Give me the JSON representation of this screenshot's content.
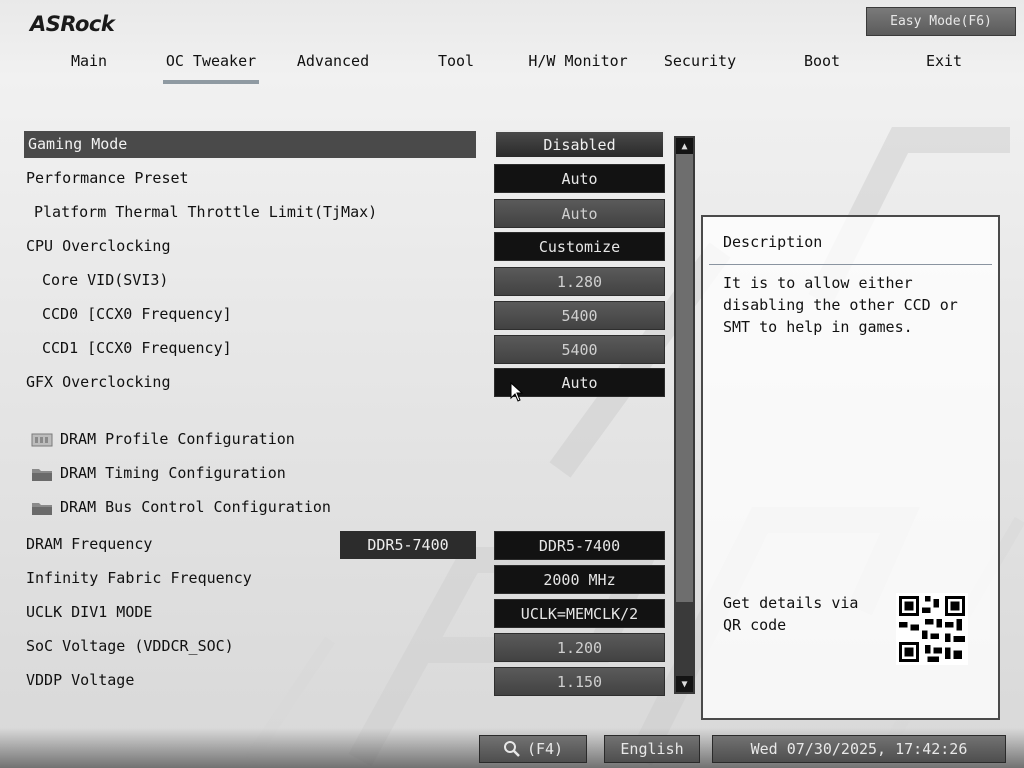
{
  "brand": "ASRock",
  "easy_mode_label": "Easy Mode(F6)",
  "tabs": [
    {
      "label": "Main"
    },
    {
      "label": "OC Tweaker"
    },
    {
      "label": "Advanced"
    },
    {
      "label": "Tool"
    },
    {
      "label": "H/W Monitor"
    },
    {
      "label": "Security"
    },
    {
      "label": "Boot"
    },
    {
      "label": "Exit"
    }
  ],
  "settings": [
    {
      "label": "Gaming Mode",
      "value": "Disabled"
    },
    {
      "label": "Performance Preset",
      "value": "Auto"
    },
    {
      "label": "Platform Thermal Throttle Limit(TjMax)",
      "value": "Auto"
    },
    {
      "label": "CPU Overclocking",
      "value": "Customize"
    },
    {
      "label": "Core VID(SVI3)",
      "value": "1.280"
    },
    {
      "label": "CCD0 [CCX0 Frequency]",
      "value": "5400"
    },
    {
      "label": "CCD1 [CCX0 Frequency]",
      "value": "5400"
    },
    {
      "label": "GFX Overclocking",
      "value": "Auto"
    }
  ],
  "submenus": [
    {
      "label": "DRAM Profile Configuration",
      "icon": "memory-icon"
    },
    {
      "label": "DRAM Timing Configuration",
      "icon": "folder-icon"
    },
    {
      "label": "DRAM Bus Control Configuration",
      "icon": "folder-icon"
    }
  ],
  "settings2": [
    {
      "label": "DRAM Frequency",
      "current": "DDR5-7400",
      "value": "DDR5-7400"
    },
    {
      "label": "Infinity Fabric Frequency",
      "value": "2000 MHz"
    },
    {
      "label": "UCLK DIV1 MODE",
      "value": "UCLK=MEMCLK/2"
    },
    {
      "label": "SoC Voltage (VDDCR_SOC)",
      "value": "1.200"
    },
    {
      "label": "VDDP Voltage",
      "value": "1.150"
    }
  ],
  "description": {
    "title": "Description",
    "text": "It is to allow either disabling the other CCD or SMT to help in games.",
    "qr_text": "Get details via QR code"
  },
  "footer": {
    "search_label": "(F4)",
    "language": "English",
    "datetime": "Wed 07/30/2025, 17:42:26"
  },
  "colors": {
    "accent_underline": "#8f9aa2",
    "selected_row": "#4a4a4a",
    "value_box": "#121212"
  }
}
